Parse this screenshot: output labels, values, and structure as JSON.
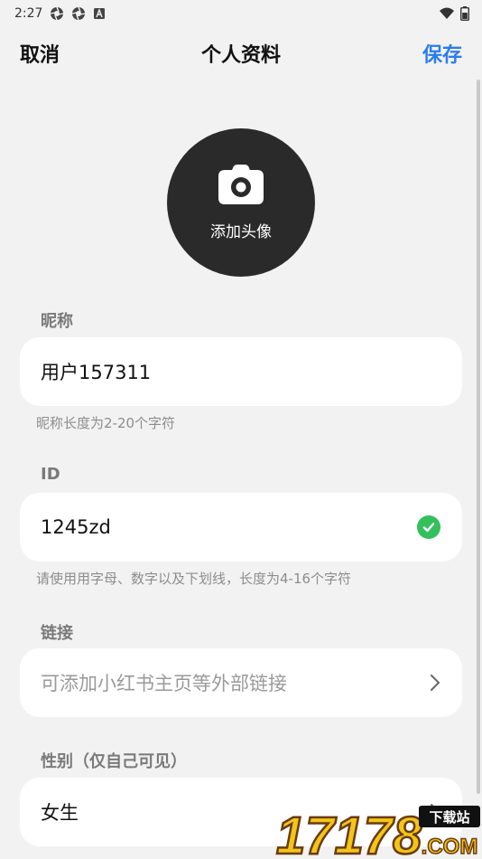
{
  "status_bar": {
    "time": "2:27"
  },
  "header": {
    "cancel_label": "取消",
    "title": "个人资料",
    "save_label": "保存"
  },
  "avatar": {
    "label": "添加头像"
  },
  "nickname": {
    "section_label": "昵称",
    "value": "用户157311",
    "hint": "昵称长度为2-20个字符"
  },
  "id_field": {
    "section_label": "ID",
    "value": "1245zd",
    "hint": "请使用用字母、数字以及下划线，长度为4-16个字符"
  },
  "link": {
    "section_label": "链接",
    "placeholder": "可添加小红书主页等外部链接"
  },
  "gender": {
    "section_label": "性别（仅自己可见）",
    "value": "女生"
  },
  "watermark": {
    "text": "17178",
    "tag": "下载站",
    "suffix": ".COM"
  },
  "colors": {
    "accent": "#2b7de9",
    "check": "#33c05b",
    "avatar_bg": "#2a2a2a",
    "page_bg": "#f2f2f3"
  }
}
